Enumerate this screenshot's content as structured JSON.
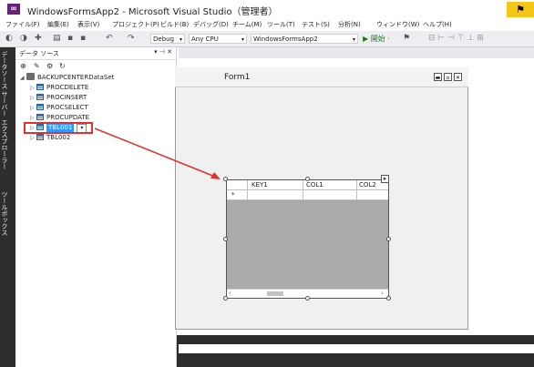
{
  "window": {
    "title": "WindowsFormsApp2 - Microsoft Visual Studio（管理者）",
    "logo_icon": "visual-studio-icon",
    "notify_icon": "notification-flag-icon"
  },
  "menu": [
    "ファイル(F)",
    "編集(E)",
    "表示(V)",
    "プロジェクト(P)",
    "ビルド(B)",
    "デバッグ(D)",
    "チーム(M)",
    "ツール(T)",
    "テスト(S)",
    "分析(N)",
    "ウィンドウ(W)",
    "ヘルプ(H)"
  ],
  "toolbar": {
    "config": "Debug",
    "platform": "Any CPU",
    "startup_project": "WindowsFormsApp2",
    "start_label": "▶ 開始 ·"
  },
  "side_tabs": [
    "データソース",
    "サーバー エクスプローラー",
    "ツールボックス"
  ],
  "data_sources": {
    "panel_title": "データ ソース",
    "panel_controls": "▾ ⊣ ✕",
    "dataset": "BACKUPCENTERDataSet",
    "items": [
      "PROCDELETE",
      "PROCINSERT",
      "PROCSELECT",
      "PROCUPDATE",
      "TBL001",
      "TBL002"
    ],
    "selected_item": "TBL001"
  },
  "designer": {
    "form_title": "Form1",
    "grid_columns": [
      "KEY1",
      "COL1",
      "COL2"
    ],
    "new_row_marker": "*"
  },
  "colors": {
    "accent": "#3399ff",
    "highlight": "#e03030",
    "ide_dark": "#2d2d30"
  }
}
